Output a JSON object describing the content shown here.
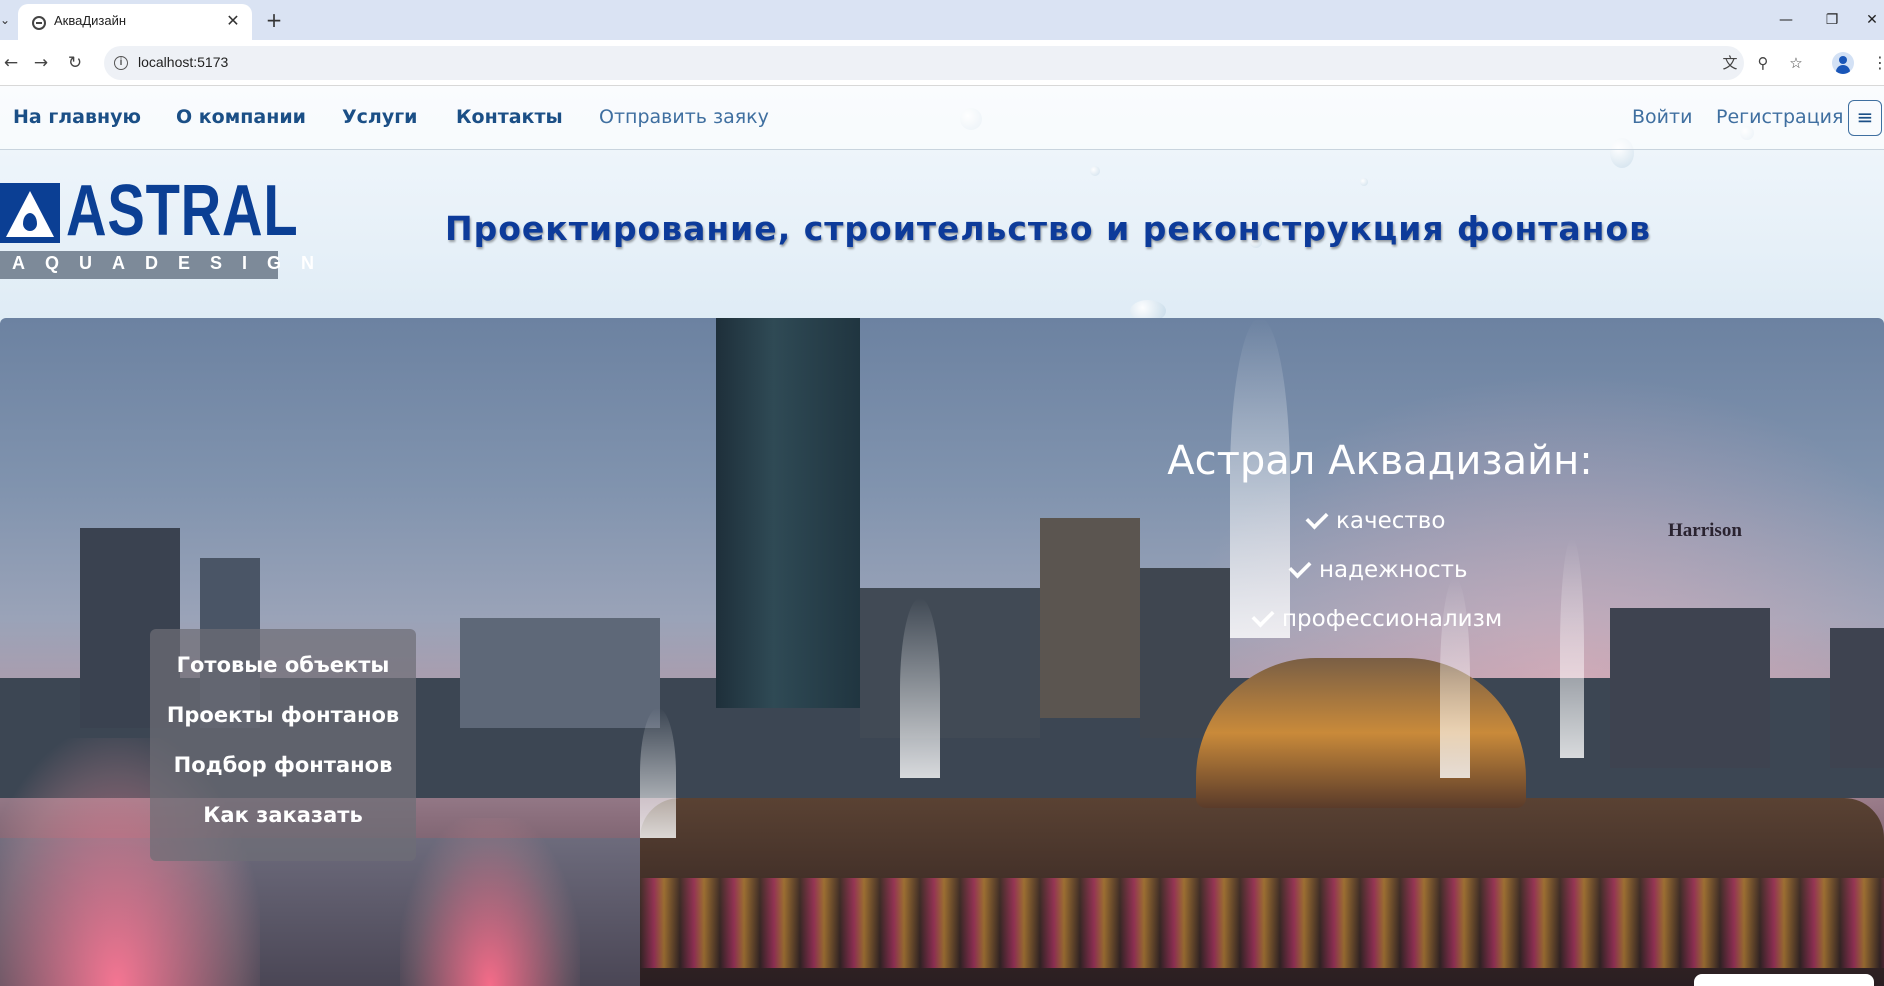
{
  "browser": {
    "tab_title": "АкваДизайн",
    "url": "localhost:5173"
  },
  "nav": {
    "home": "На главную",
    "about": "О компании",
    "services": "Услуги",
    "contacts": "Контакты",
    "request": "Отправить заяку",
    "login": "Войти",
    "register": "Регистрация"
  },
  "logo": {
    "main": "ASTRAL",
    "sub": "AQUADESIGN"
  },
  "headline": "Проектирование, строительство и реконструкция фонтанов",
  "hero": {
    "sign": "Harrison",
    "tagline": "Астрал Аквадизайн:",
    "features": [
      "качество",
      "надежность",
      "профессионализм"
    ],
    "menu": [
      "Готовые объекты",
      "Проекты фонтанов",
      "Подбор фонтанов",
      "Как заказать"
    ]
  },
  "colors": {
    "nav_link": "#1b4f86",
    "headline": "#0d3b9a",
    "logo_blue": "#0b3f94"
  },
  "icons": {
    "tab_favicon": "globe-icon",
    "close": "close-icon",
    "back": "arrow-left-icon",
    "forward": "arrow-right-icon",
    "reload": "reload-icon",
    "info": "info-icon",
    "translate": "translate-icon",
    "zoom": "zoom-icon",
    "bookmark": "star-icon",
    "profile": "profile-icon",
    "menu": "hamburger-icon",
    "check": "check-icon"
  }
}
